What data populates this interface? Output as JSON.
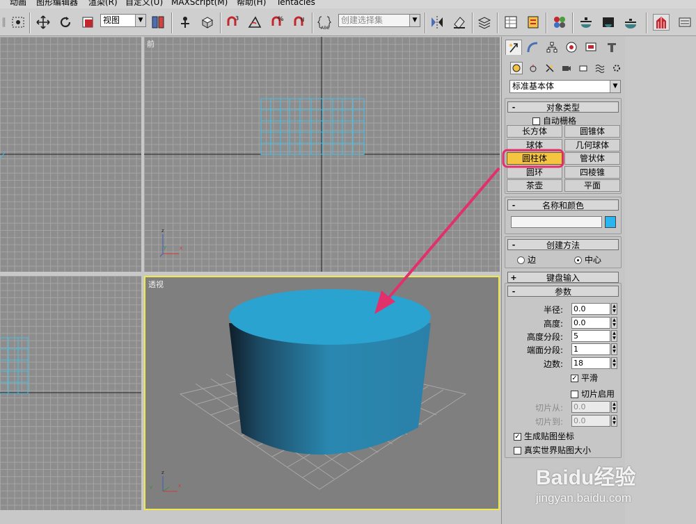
{
  "menu": [
    "动画",
    "图形编辑器",
    "渲染(R)",
    "自定义(U)",
    "MAXScript(M)",
    "帮助(H)",
    "Tentacles"
  ],
  "toolbar": {
    "view_dropdown": "视图",
    "named_selection_placeholder": "创建选择集"
  },
  "viewports": {
    "front": "前",
    "perspective": "透视",
    "axis_x": "x",
    "axis_y": "y",
    "axis_z": "z"
  },
  "panel": {
    "category_dropdown": "标准基本体",
    "object_type": {
      "title": "对象类型",
      "autogrid": "自动栅格",
      "buttons": [
        "长方体",
        "圆锥体",
        "球体",
        "几何球体",
        "圆柱体",
        "管状体",
        "圆环",
        "四棱锥",
        "茶壶",
        "平面"
      ],
      "selected": "圆柱体"
    },
    "name_color": {
      "title": "名称和颜色",
      "object_name": "",
      "color": "#29b6f0"
    },
    "creation_method": {
      "title": "创建方法",
      "options": [
        "边",
        "中心"
      ],
      "selected": "中心"
    },
    "keyboard_entry": {
      "title": "键盘输入"
    },
    "parameters": {
      "title": "参数",
      "radius": {
        "label": "半径:",
        "value": "0.0"
      },
      "height": {
        "label": "高度:",
        "value": "0.0"
      },
      "height_segments": {
        "label": "高度分段:",
        "value": "5"
      },
      "cap_segments": {
        "label": "端面分段:",
        "value": "1"
      },
      "sides": {
        "label": "边数:",
        "value": "18"
      },
      "smooth": {
        "label": "平滑",
        "checked": true
      },
      "slice_on": {
        "label": "切片启用",
        "checked": false
      },
      "slice_from": {
        "label": "切片从:",
        "value": "0.0"
      },
      "slice_to": {
        "label": "切片到:",
        "value": "0.0"
      },
      "gen_mapping": {
        "label": "生成贴图坐标",
        "checked": true
      },
      "real_world": {
        "label": "真实世界贴图大小",
        "checked": false
      }
    }
  },
  "watermark": {
    "brand": "Baidu经验",
    "url": "jingyan.baidu.com"
  },
  "colors": {
    "cylinder": "#2a9ec8",
    "highlight": "#e2306a",
    "viewport_active": "#f0e84a"
  }
}
